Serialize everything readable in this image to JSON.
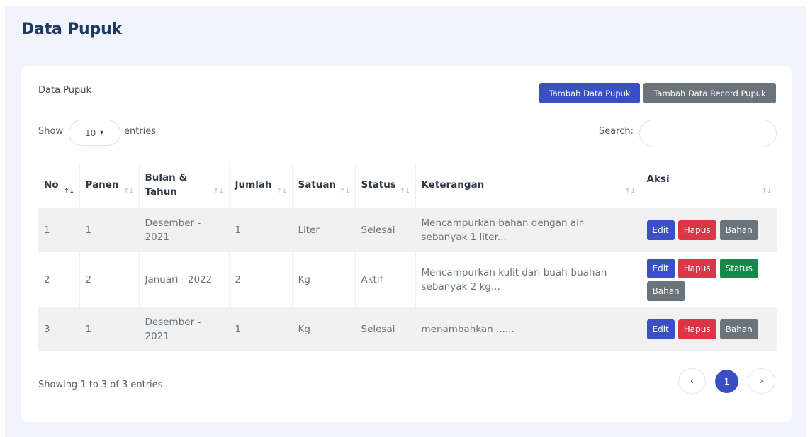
{
  "page": {
    "title": "Data Pupuk"
  },
  "card": {
    "title": "Data Pupuk",
    "add_button": "Tambah Data Pupuk",
    "add_record_button": "Tambah Data Record Pupuk"
  },
  "length": {
    "show": "Show",
    "value": "10",
    "entries": "entries"
  },
  "search": {
    "label": "Search:",
    "value": ""
  },
  "table": {
    "headers": [
      "No",
      "Panen",
      "Bulan & Tahun",
      "Jumlah",
      "Satuan",
      "Status",
      "Keterangan",
      "Aksi"
    ],
    "sort_icon": "↑↓",
    "rows": [
      {
        "no": "1",
        "panen": "1",
        "bulan": "Desember - 2021",
        "jumlah": "1",
        "satuan": "Liter",
        "status": "Selesai",
        "keterangan": "Mencampurkan bahan dengan air sebanyak 1 liter...",
        "actions": [
          "Edit",
          "Hapus",
          "Bahan"
        ]
      },
      {
        "no": "2",
        "panen": "2",
        "bulan": "Januari - 2022",
        "jumlah": "2",
        "satuan": "Kg",
        "status": "Aktif",
        "keterangan": "Mencampurkan kulit dari buah-buahan sebanyak 2 kg...",
        "actions": [
          "Edit",
          "Hapus",
          "Status",
          "Bahan"
        ]
      },
      {
        "no": "3",
        "panen": "1",
        "bulan": "Desember - 2021",
        "jumlah": "1",
        "satuan": "Kg",
        "status": "Selesai",
        "keterangan": "menambahkan ......",
        "actions": [
          "Edit",
          "Hapus",
          "Bahan"
        ]
      }
    ]
  },
  "footer": {
    "info": "Showing 1 to 3 of 3 entries"
  },
  "pagination": {
    "prev": "‹",
    "current": "1",
    "next": "›"
  },
  "icons": {
    "select_caret": "chevron-down-icon",
    "sort": "sort-icon"
  }
}
